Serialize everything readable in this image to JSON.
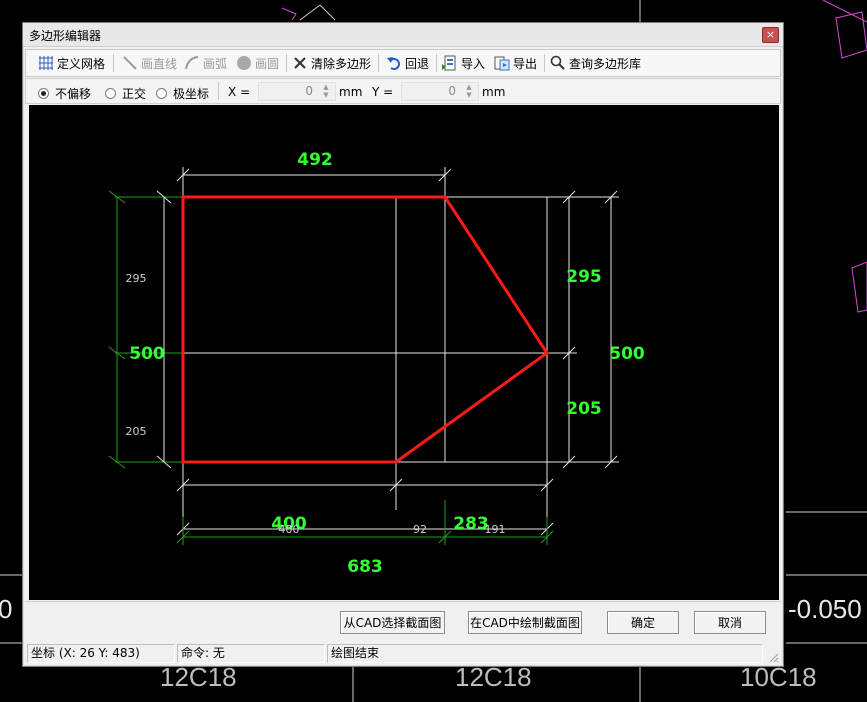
{
  "background": {
    "labels": [
      "0",
      "-0.050",
      "12C18",
      "12C18",
      "10C18"
    ]
  },
  "dialog": {
    "title": "多边形编辑器",
    "close_symbol": "×"
  },
  "toolbar": {
    "define_grid": "定义网格",
    "draw_line": "画直线",
    "draw_arc": "画弧",
    "draw_circle": "画圆",
    "clear_polygon": "清除多边形",
    "undo": "回退",
    "import": "导入",
    "export": "导出",
    "query_library": "查询多边形库"
  },
  "snap": {
    "options": [
      {
        "label": "不偏移",
        "checked": true
      },
      {
        "label": "正交",
        "checked": false
      },
      {
        "label": "极坐标",
        "checked": false
      }
    ],
    "x_label": "X =",
    "x_value": "0",
    "x_unit": "mm",
    "y_label": "Y =",
    "y_value": "0",
    "y_unit": "mm"
  },
  "drawing": {
    "colors": {
      "polygon": "#ff1a1a",
      "dims": "#33ff33",
      "grid": "#e6e6e6",
      "small_dims": "#cfcfcf",
      "ext_lines": "#1f9e1f"
    },
    "dims_large": {
      "top": "492",
      "left": "500",
      "right_upper": "295",
      "right_lower": "205",
      "right_outer": "500",
      "bottom_left": "400",
      "bottom_right": "283",
      "bottom_total": "683"
    },
    "dims_small": {
      "left_upper": "295",
      "left_lower": "205",
      "bottom_a": "400",
      "bottom_b": "92",
      "bottom_c": "191"
    }
  },
  "buttons": {
    "select_from_cad": "从CAD选择截面图",
    "draw_in_cad": "在CAD中绘制截面图",
    "ok": "确定",
    "cancel": "取消"
  },
  "status": {
    "coords": "坐标 (X: 26 Y: 483)",
    "command": "命令: 无",
    "message": "绘图结束"
  }
}
